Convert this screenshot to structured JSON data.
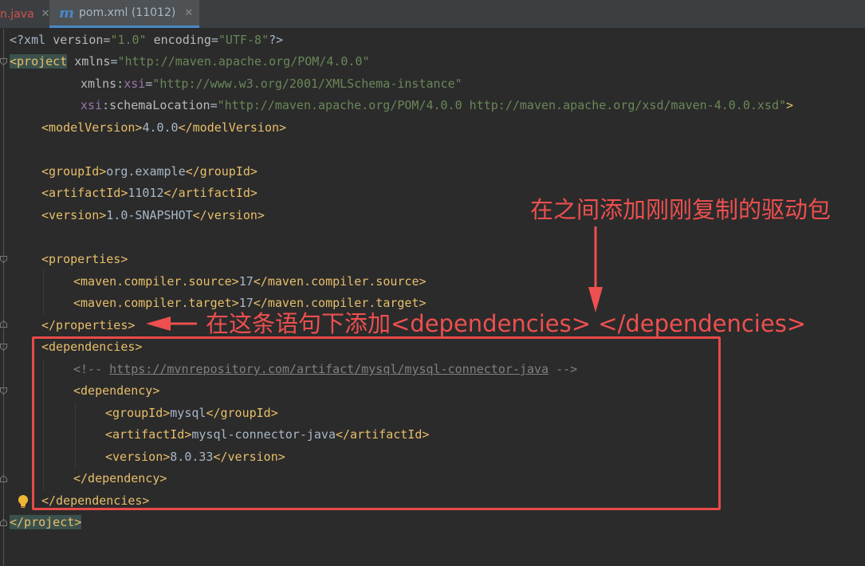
{
  "tabs": [
    {
      "label": "n.java",
      "close": "✕"
    },
    {
      "label": "pom.xml (11012)",
      "icon": "m",
      "close": "✕"
    }
  ],
  "code": {
    "l1": {
      "p1": "<?xml ",
      "a1": "version",
      "e1": "=",
      "v1": "\"1.0\"",
      "a2": " encoding",
      "e2": "=",
      "v2": "\"UTF-8\"",
      "p2": "?>"
    },
    "l2": {
      "t": "<project",
      "a": " xmlns",
      "e": "=",
      "v": "\"http://maven.apache.org/POM/4.0.0\""
    },
    "l3": {
      "a": "xmlns",
      "c": ":",
      "n": "xsi",
      "e": "=",
      "v": "\"http://www.w3.org/2001/XMLSchema-instance\""
    },
    "l4": {
      "n": "xsi",
      "c": ":",
      "a": "schemaLocation",
      "e": "=",
      "v": "\"http://maven.apache.org/POM/4.0.0 http://maven.apache.org/xsd/maven-4.0.0.xsd\"",
      "end": ">"
    },
    "l5": {
      "o": "<modelVersion>",
      "t": "4.0.0",
      "c": "</modelVersion>"
    },
    "l7": {
      "o": "<groupId>",
      "t": "org.example",
      "c": "</groupId>"
    },
    "l8": {
      "o": "<artifactId>",
      "t": "11012",
      "c": "</artifactId>"
    },
    "l9": {
      "o": "<version>",
      "t": "1.0-SNAPSHOT",
      "c": "</version>"
    },
    "l11": "<properties>",
    "l12": {
      "o": "<maven.compiler.source>",
      "t": "17",
      "c": "</maven.compiler.source>"
    },
    "l13": {
      "o": "<maven.compiler.target>",
      "t": "17",
      "c": "</maven.compiler.target>"
    },
    "l14": "</properties>",
    "l15": "<dependencies>",
    "l16": {
      "o": "<!-- ",
      "u": "https://mvnrepository.com/artifact/mysql/mysql-connector-java",
      "c": " -->"
    },
    "l17": "<dependency>",
    "l18": {
      "o": "<groupId>",
      "t": "mysql",
      "c": "</groupId>"
    },
    "l19": {
      "o": "<artifactId>",
      "t": "mysql-connector-java",
      "c": "</artifactId>"
    },
    "l20": {
      "o": "<version>",
      "t": "8.0.33",
      "c": "</version>"
    },
    "l21": "</dependency>",
    "l22": "</dependencies>",
    "l23": "</project>"
  },
  "annotations": {
    "top": "在之间添加刚刚复制的驱动包",
    "middle": "在这条语句下添加<dependencies> </dependencies>"
  },
  "colors": {
    "annotation": "#ee4f4f",
    "tag": "#e8bf6a",
    "value": "#6a8759",
    "namespace": "#9876aa"
  }
}
